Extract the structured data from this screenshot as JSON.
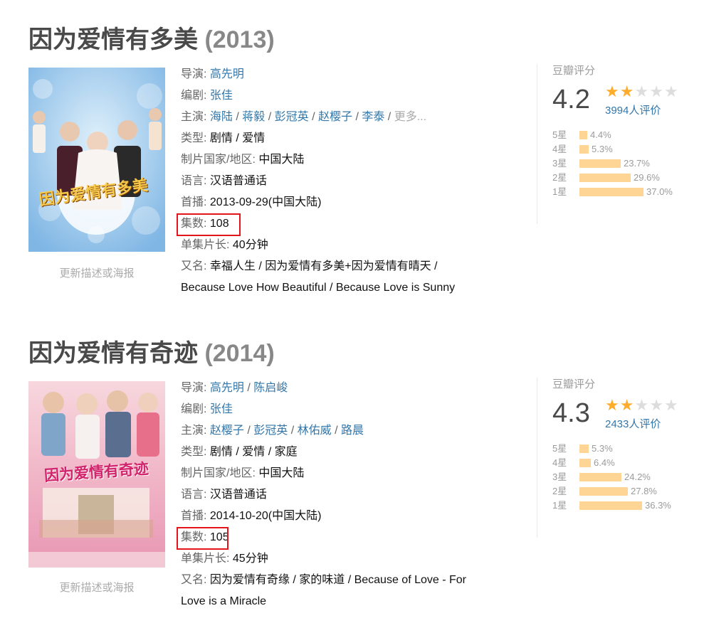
{
  "entries": [
    {
      "title": "因为爱情有多美",
      "year": "(2013)",
      "poster_title_art": "因为爱情有多美",
      "update_link": "更新描述或海报",
      "director_label": "导演",
      "directors": [
        "高先明"
      ],
      "writer_label": "编剧",
      "writers": [
        "张佳"
      ],
      "cast_label": "主演",
      "cast": [
        "海陆",
        "蒋毅",
        "彭冠英",
        "赵樱子",
        "李泰"
      ],
      "cast_more": "更多...",
      "genre_label": "类型",
      "genre": "剧情 / 爱情",
      "country_label": "制片国家/地区",
      "country": "中国大陆",
      "language_label": "语言",
      "language": "汉语普通话",
      "premiere_label": "首播",
      "premiere": "2013-09-29(中国大陆)",
      "episodes_label": "集数",
      "episodes": "108",
      "runtime_label": "单集片长",
      "runtime": "40分钟",
      "aka_label": "又名",
      "aka_line1": "幸福人生 / 因为爱情有多美+因为爱情有晴天 /",
      "aka_line2": "Because Love How Beautiful / Because Love is Sunny",
      "rating_label": "豆瓣评分",
      "score": "4.2",
      "stars_full": 2,
      "votes": "3994人评价",
      "distribution": [
        {
          "label": "5星",
          "pct": "4.4%",
          "value": 4.4
        },
        {
          "label": "4星",
          "pct": "5.3%",
          "value": 5.3
        },
        {
          "label": "3星",
          "pct": "23.7%",
          "value": 23.7
        },
        {
          "label": "2星",
          "pct": "29.6%",
          "value": 29.6
        },
        {
          "label": "1星",
          "pct": "37.0%",
          "value": 37.0
        }
      ]
    },
    {
      "title": "因为爱情有奇迹",
      "year": "(2014)",
      "poster_title_art": "因为爱情有奇迹",
      "update_link": "更新描述或海报",
      "director_label": "导演",
      "directors": [
        "高先明",
        "陈启峻"
      ],
      "writer_label": "编剧",
      "writers": [
        "张佳"
      ],
      "cast_label": "主演",
      "cast": [
        "赵樱子",
        "彭冠英",
        "林佑威",
        "路晨"
      ],
      "cast_more": "",
      "genre_label": "类型",
      "genre": "剧情 / 爱情 / 家庭",
      "country_label": "制片国家/地区",
      "country": "中国大陆",
      "language_label": "语言",
      "language": "汉语普通话",
      "premiere_label": "首播",
      "premiere": "2014-10-20(中国大陆)",
      "episodes_label": "集数",
      "episodes": "105",
      "runtime_label": "单集片长",
      "runtime": "45分钟",
      "aka_label": "又名",
      "aka_line1": "因为爱情有奇缘 / 家的味道 / Because of Love - For",
      "aka_line2": "Love is a Miracle",
      "rating_label": "豆瓣评分",
      "score": "4.3",
      "stars_full": 2,
      "votes": "2433人评价",
      "distribution": [
        {
          "label": "5星",
          "pct": "5.3%",
          "value": 5.3
        },
        {
          "label": "4星",
          "pct": "6.4%",
          "value": 6.4
        },
        {
          "label": "3星",
          "pct": "24.2%",
          "value": 24.2
        },
        {
          "label": "2星",
          "pct": "27.8%",
          "value": 27.8
        },
        {
          "label": "1星",
          "pct": "36.3%",
          "value": 36.3
        }
      ]
    }
  ]
}
